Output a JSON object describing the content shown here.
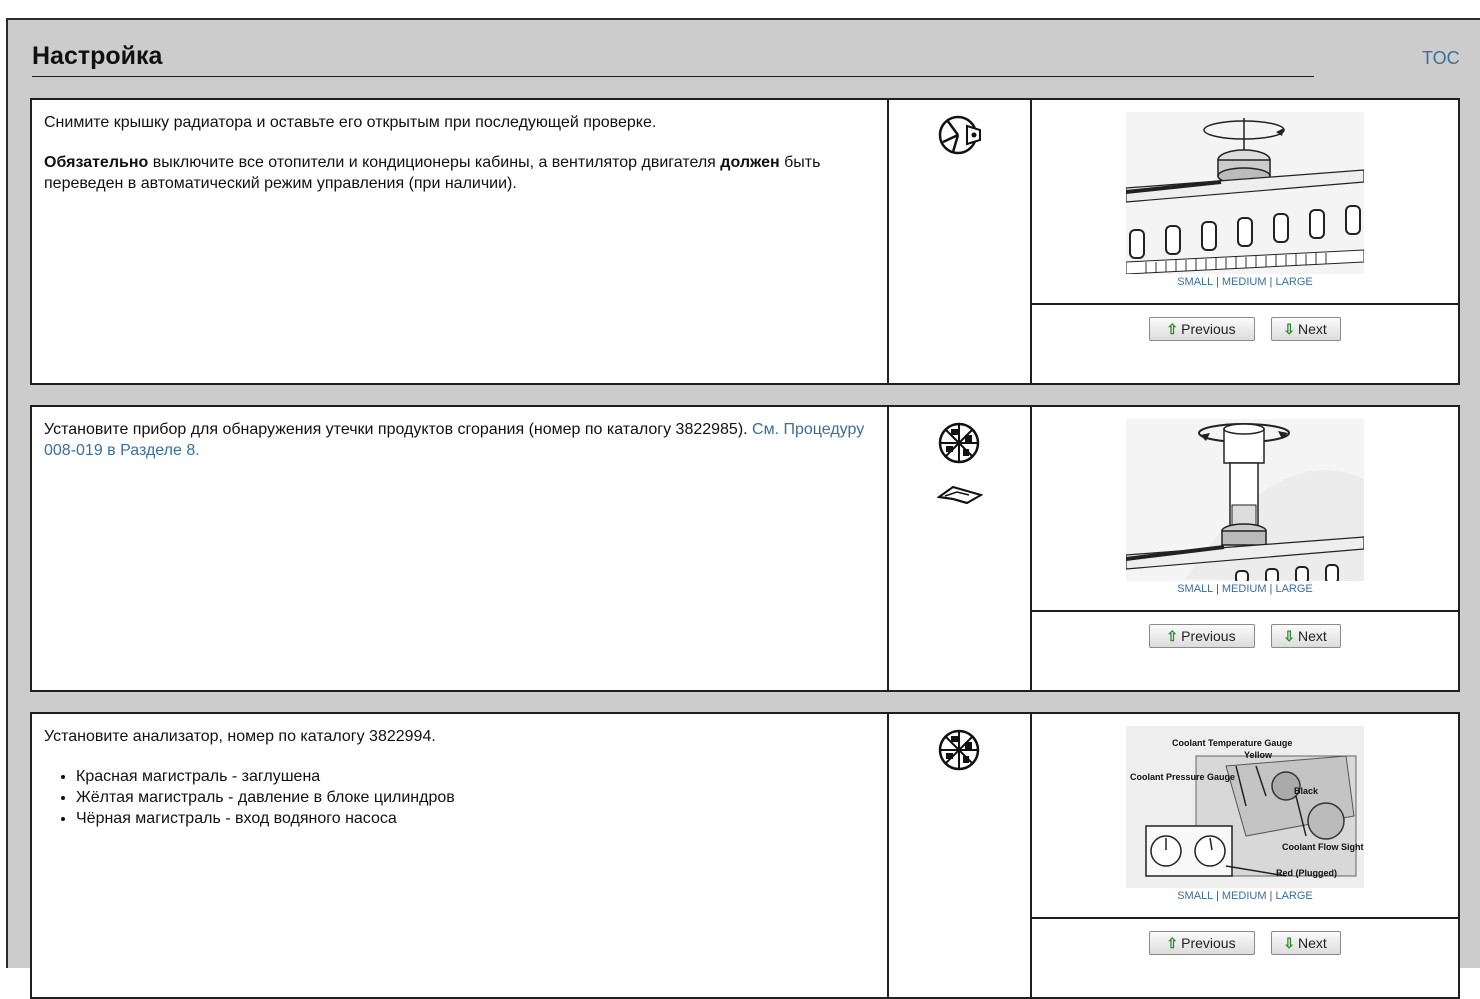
{
  "header": {
    "title": "Настройка",
    "toc": "TOC"
  },
  "steps": [
    {
      "p1": "Снимите крышку радиатора и оставьте его открытым при последующей проверке.",
      "p2_bold1": "Обязательно",
      "p2_mid": " выключите все отопители и кондиционеры кабины, а вентилятор двигателя ",
      "p2_bold2": "должен",
      "p2_end": " быть переведен в автоматический режим управления (при наличии).",
      "icons": [
        "wrench-open-icon"
      ]
    },
    {
      "p1": "Установите прибор для обнаружения утечки продуктов сгорания (номер по каталогу 3822985). ",
      "p1_link": "См. Процедуру 008-019 в Разделе 8.",
      "icons": [
        "measure-icon",
        "reference-icon"
      ]
    },
    {
      "p1": "Установите анализатор, номер по каталогу 3822994.",
      "bullets": [
        "Красная магистраль - заглушена",
        "Жёлтая магистраль - давление в блоке цилиндров",
        "Чёрная магистраль - вход водяного насоса"
      ],
      "icons": [
        "measure-icon"
      ],
      "fig_labels": [
        "Coolant Temperature Gauge",
        "Yellow",
        "Coolant Pressure Gauge",
        "Black",
        "Coolant Flow Sight Glass",
        "Red (Plugged)"
      ]
    }
  ],
  "figure": {
    "small": "SMALL",
    "medium": "MEDIUM",
    "large": "LARGE",
    "sep": " | ",
    "prev": "Previous",
    "next": "Next"
  }
}
